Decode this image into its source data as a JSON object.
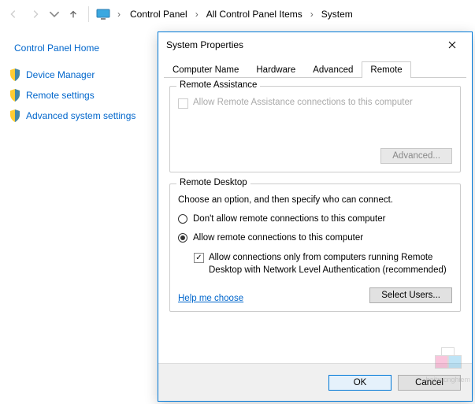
{
  "nav": {
    "crumbs": [
      "Control Panel",
      "All Control Panel Items",
      "System"
    ]
  },
  "sidebar": {
    "home": "Control Panel Home",
    "links": [
      "Device Manager",
      "Remote settings",
      "Advanced system settings"
    ]
  },
  "dialog": {
    "title": "System Properties",
    "tabs": [
      "Computer Name",
      "Hardware",
      "Advanced",
      "Remote"
    ],
    "active_tab": 3,
    "group1": {
      "title": "Remote Assistance",
      "chk_label": "Allow Remote Assistance connections to this computer",
      "advanced_btn": "Advanced..."
    },
    "group2": {
      "title": "Remote Desktop",
      "desc": "Choose an option, and then specify who can connect.",
      "radio1": "Don't allow remote connections to this computer",
      "radio2": "Allow remote connections to this computer",
      "nla_chk": "Allow connections only from computers running Remote Desktop with Network Level Authentication (recommended)",
      "help": "Help me choose",
      "select_users": "Select Users..."
    },
    "buttons": {
      "ok": "OK",
      "cancel": "Cancel"
    }
  },
  "watermark": "baitracnghiem"
}
